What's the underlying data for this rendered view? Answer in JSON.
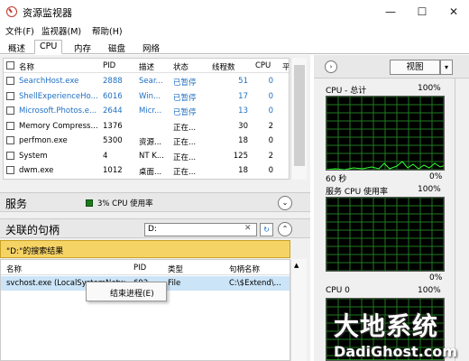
{
  "window": {
    "title": "资源监视器",
    "minimize": "—",
    "maximize": "☐",
    "close": "✕"
  },
  "menu": [
    "文件(F)",
    "监视器(M)",
    "帮助(H)"
  ],
  "tabs": [
    "概述",
    "CPU",
    "内存",
    "磁盘",
    "网络"
  ],
  "process_table": {
    "headers": [
      "名称",
      "PID",
      "描述",
      "状态",
      "线程数",
      "CPU",
      "平"
    ],
    "rows": [
      {
        "name": "SearchHost.exe",
        "pid": "2888",
        "desc": "Sear...",
        "status": "已暂停",
        "threads": "51",
        "cpu": "0",
        "suspended": true
      },
      {
        "name": "ShellExperienceHo...",
        "pid": "6016",
        "desc": "Win...",
        "status": "已暂停",
        "threads": "17",
        "cpu": "0",
        "suspended": true
      },
      {
        "name": "Microsoft.Photos.e...",
        "pid": "2644",
        "desc": "Micr...",
        "status": "已暂停",
        "threads": "13",
        "cpu": "0",
        "suspended": true
      },
      {
        "name": "Memory Compress...",
        "pid": "1376",
        "desc": "",
        "status": "正在...",
        "threads": "30",
        "cpu": "2",
        "suspended": false
      },
      {
        "name": "perfmon.exe",
        "pid": "5300",
        "desc": "资源...",
        "status": "正在...",
        "threads": "18",
        "cpu": "0",
        "suspended": false
      },
      {
        "name": "System",
        "pid": "4",
        "desc": "NT K...",
        "status": "正在...",
        "threads": "125",
        "cpu": "2",
        "suspended": false
      },
      {
        "name": "dwm.exe",
        "pid": "1012",
        "desc": "桌面...",
        "status": "正在...",
        "threads": "18",
        "cpu": "0",
        "suspended": false
      }
    ]
  },
  "services": {
    "title": "服务",
    "cpu_usage": "3% CPU 使用率",
    "collapse": "⌄"
  },
  "handles": {
    "title": "关联的句柄",
    "search_value": "D:",
    "search_clear": "✕",
    "search_go": "↻",
    "collapse": "⌃",
    "result_text": "\"D:\"的搜索结果",
    "headers": [
      "名称",
      "PID",
      "类型",
      "句柄名称"
    ],
    "row": {
      "name": "svchost.exe (LocalSystemNetw...",
      "pid": "692",
      "type": "File",
      "handle": "C:\\$Extend\\..."
    }
  },
  "context_menu": {
    "item": "结束进程(E)"
  },
  "right_panel": {
    "nav": "›",
    "view_label": "视图",
    "view_arrow": "▾",
    "cpu_total": {
      "label": "CPU - 总计",
      "max": "100%",
      "time": "60 秒",
      "min": "0%"
    },
    "service_cpu": {
      "label": "服务 CPU 使用率",
      "max": "100%",
      "min": "0%"
    },
    "cpu0": {
      "label": "CPU 0",
      "max": "100%"
    }
  },
  "watermark": {
    "big": "大地系统",
    "small": "DadiGhost.com"
  },
  "colors": {
    "graph_bg": "#000000",
    "graph_grid": "#1f7a1f",
    "graph_line": "#33ff33",
    "suspended_text": "#1e6fc4",
    "result_bar": "#f6d365"
  }
}
